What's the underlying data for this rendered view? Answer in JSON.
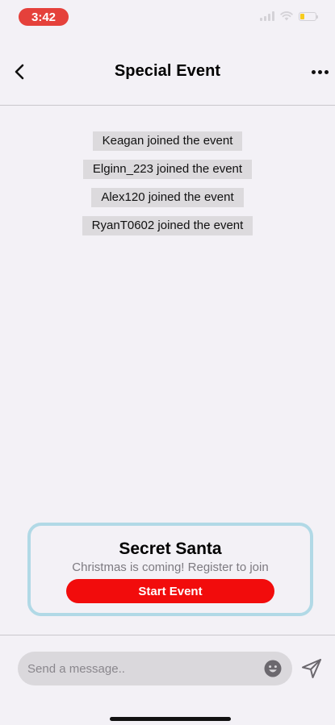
{
  "status_bar": {
    "time": "3:42",
    "icons": [
      "cellular-signal-icon",
      "wifi-icon",
      "battery-icon"
    ],
    "battery_level": 0.3,
    "battery_color": "#f7cc1e",
    "time_pill_color": "#e5413b"
  },
  "header": {
    "title": "Special Event",
    "back_icon": "chevron-left-icon",
    "more_icon": "more-horizontal-icon"
  },
  "event_log": [
    "Keagan joined the event",
    "Elginn_223 joined the event",
    "Alex120 joined the event",
    "RyanT0602 joined the event"
  ],
  "event_card": {
    "title": "Secret Santa",
    "subtitle": "Christmas is coming! Register to join",
    "button_label": "Start Event",
    "border_color": "#b1d9e6",
    "button_color": "#f20c0c"
  },
  "composer": {
    "placeholder": "Send a message..",
    "emoji_icon": "emoji-icon",
    "send_icon": "send-icon"
  }
}
